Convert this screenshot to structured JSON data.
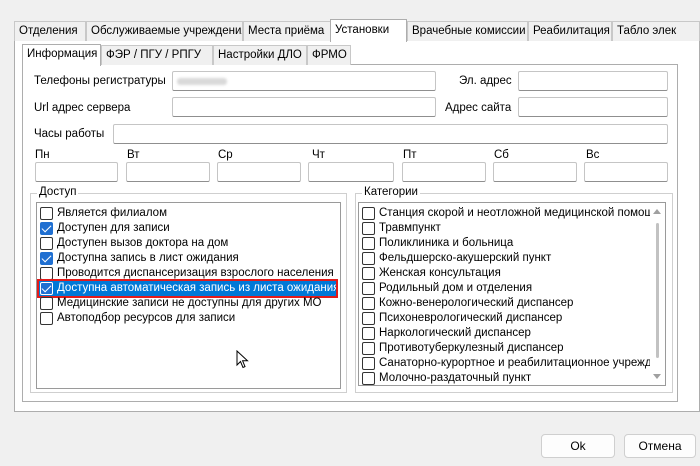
{
  "top_tabs": [
    "Отделения",
    "Обслуживаемые учреждения",
    "Места приёма",
    "Установки",
    "Врачебные комиссии",
    "Реабилитация",
    "Табло элек"
  ],
  "active_top_tab": "Установки",
  "sub_tabs": [
    "Информация",
    "ФЭР / ПГУ / РПГУ",
    "Настройки ДЛО",
    "ФРМО"
  ],
  "active_sub_tab": "Информация",
  "fields": {
    "phones_label": "Телефоны регистратуры",
    "email_label": "Эл. адрес",
    "url_label": "Url адрес сервера",
    "site_label": "Адрес сайта",
    "hours_label": "Часы работы"
  },
  "days": [
    "Пн",
    "Вт",
    "Ср",
    "Чт",
    "Пт",
    "Сб",
    "Вс"
  ],
  "access": {
    "title": "Доступ",
    "items": [
      {
        "label": "Является филиалом",
        "checked": false
      },
      {
        "label": "Доступен для записи",
        "checked": true
      },
      {
        "label": "Доступен вызов доктора на дом",
        "checked": false
      },
      {
        "label": "Доступна запись в лист ожидания",
        "checked": true
      },
      {
        "label": "Проводится диспансеризация взрослого населения",
        "checked": false
      },
      {
        "label": "Доступна автоматическая запись из листа ожидания",
        "checked": true,
        "selected": true
      },
      {
        "label": "Медицинские записи не доступны для других МО",
        "checked": false
      },
      {
        "label": "Автоподбор ресурсов для записи",
        "checked": false
      }
    ]
  },
  "categories": {
    "title": "Категории",
    "items": [
      {
        "label": "Станция скорой и неотложной медицинской помощи",
        "checked": false
      },
      {
        "label": "Травмпункт",
        "checked": false
      },
      {
        "label": "Поликлиника и больница",
        "checked": false
      },
      {
        "label": "Фельдшерско-акушерский пункт",
        "checked": false
      },
      {
        "label": "Женская консультация",
        "checked": false
      },
      {
        "label": "Родильный дом и отделения",
        "checked": false
      },
      {
        "label": "Кожно-венерологический диспансер",
        "checked": false
      },
      {
        "label": "Психоневрологический диспансер",
        "checked": false
      },
      {
        "label": "Наркологический диспансер",
        "checked": false
      },
      {
        "label": "Противотуберкулезный диспансер",
        "checked": false
      },
      {
        "label": "Санаторно-курортное и реабилитационное учреждение",
        "checked": false
      },
      {
        "label": "Молочно-раздаточный пункт",
        "checked": false
      }
    ]
  },
  "buttons": {
    "ok": "Ok",
    "cancel": "Отмена"
  },
  "colors": {
    "selection": "#0078d7",
    "highlight_border": "#e21b1b",
    "checkbox_checked": "#1f6fd1"
  }
}
